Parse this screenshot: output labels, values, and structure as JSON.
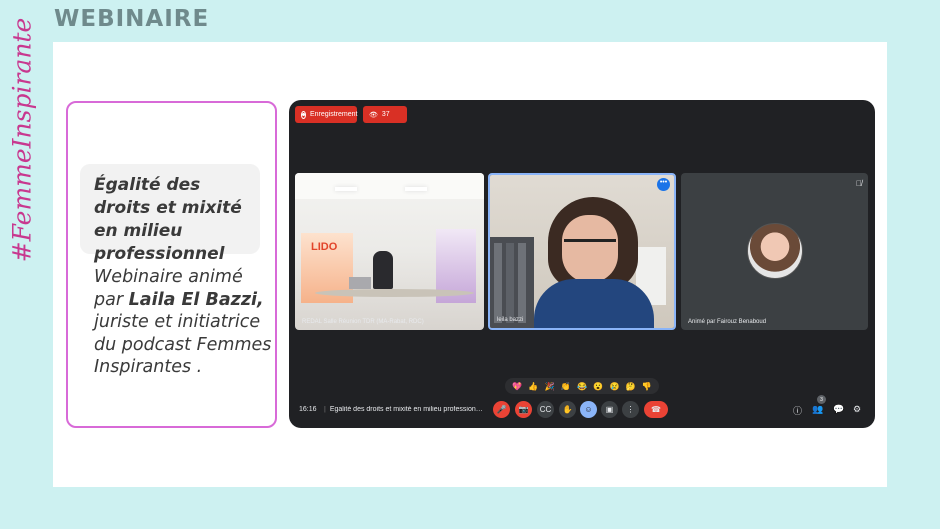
{
  "slide": {
    "heading": "WEBINAIRE",
    "side_tag": "#FemmeInspirante"
  },
  "info": {
    "topic": "Égalité des droits et mixité en milieu professionnel",
    "host_prefix": "Webinaire animé par",
    "host_name": "Laila El Bazzi,",
    "host_suffix": "juriste et initiatrice du podcast Femmes Inspirantes ."
  },
  "meet": {
    "recording_label": "Enregistrement",
    "viewers": "37",
    "banner_text": "LIDO",
    "tiles": [
      {
        "name": "REDAL Salle Réunion TDR (MA-Rabat, RDC)"
      },
      {
        "name": "leila bazzi",
        "menu": "•••"
      },
      {
        "name": "Animé par Fairouz Benaboud",
        "mic": "🎙̸"
      }
    ],
    "reactions": [
      "💖",
      "👍",
      "🎉",
      "👏",
      "😂",
      "😮",
      "😢",
      "🤔",
      "👎"
    ],
    "time": "16:16",
    "title": "Égalité des droits et mixité en milieu professionnel",
    "controls": {
      "mic": "🎤",
      "camera": "📷",
      "captions": "CC",
      "hand": "✋",
      "emoji": "☺",
      "present": "▣",
      "more": "⋮",
      "hangup": "☎"
    },
    "right": {
      "info": "ⓘ",
      "people": "👥",
      "people_count": "3",
      "chat": "💬",
      "activities": "⚙"
    }
  }
}
